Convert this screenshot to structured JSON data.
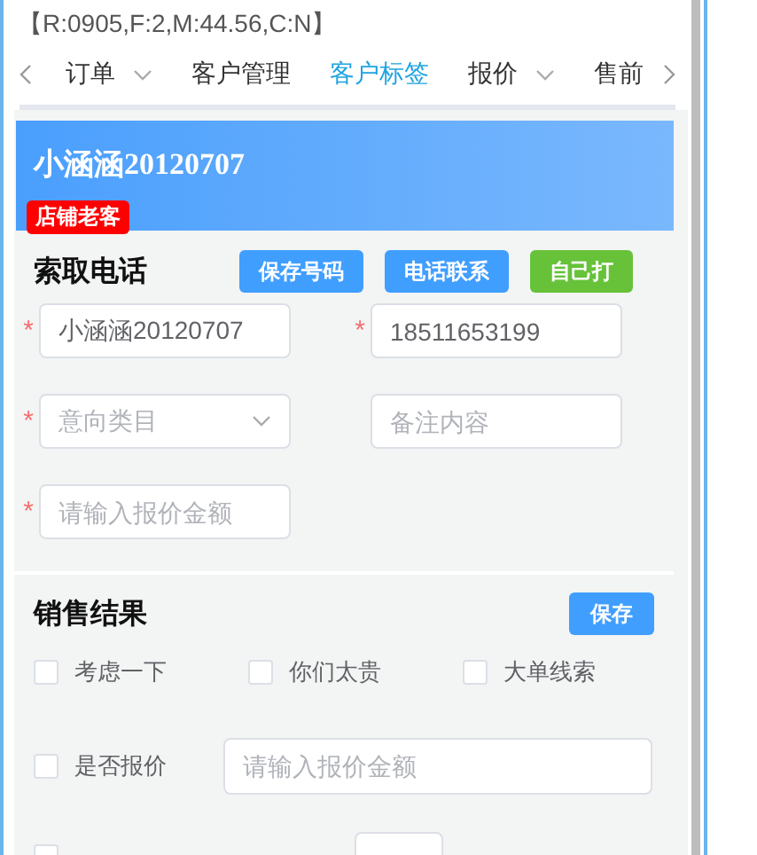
{
  "status_text": "【R:0905,F:2,M:44.56,C:N】",
  "tabs": [
    {
      "label": "订单",
      "dropdown": true,
      "selected": false
    },
    {
      "label": "客户管理",
      "dropdown": false,
      "selected": false
    },
    {
      "label": "客户标签",
      "dropdown": false,
      "selected": true
    },
    {
      "label": "报价",
      "dropdown": true,
      "selected": false
    },
    {
      "label": "售前",
      "dropdown": false,
      "selected": false
    }
  ],
  "customer_card": {
    "name": "小涵涵20120707",
    "badge": "店铺老客"
  },
  "phone_section": {
    "title": "索取电话",
    "buttons": [
      {
        "label": "保存号码",
        "kind": "primary"
      },
      {
        "label": "电话联系",
        "kind": "primary"
      },
      {
        "label": "自己打",
        "kind": "success"
      }
    ],
    "fields": [
      {
        "kind": "input",
        "value": "小涵涵20120707",
        "required_mark": "*"
      },
      {
        "kind": "input",
        "value": "18511653199",
        "required_mark": "*"
      },
      {
        "kind": "select",
        "placeholder": "意向类目",
        "required_mark": "*"
      },
      {
        "kind": "input",
        "placeholder": "备注内容"
      },
      {
        "kind": "input",
        "placeholder": "请输入报价金额",
        "required_mark": "*"
      }
    ]
  },
  "sales_section": {
    "title": "销售结果",
    "save_button": "保存",
    "options": [
      {
        "label": "考虑一下",
        "checked": false
      },
      {
        "label": "你们太贵",
        "checked": false
      },
      {
        "label": "大单线索",
        "checked": false
      }
    ],
    "quote_row": {
      "label": "是否报价",
      "checked": false,
      "placeholder": "请输入报价金额"
    },
    "repurchase_row": {
      "checked": false
    }
  }
}
